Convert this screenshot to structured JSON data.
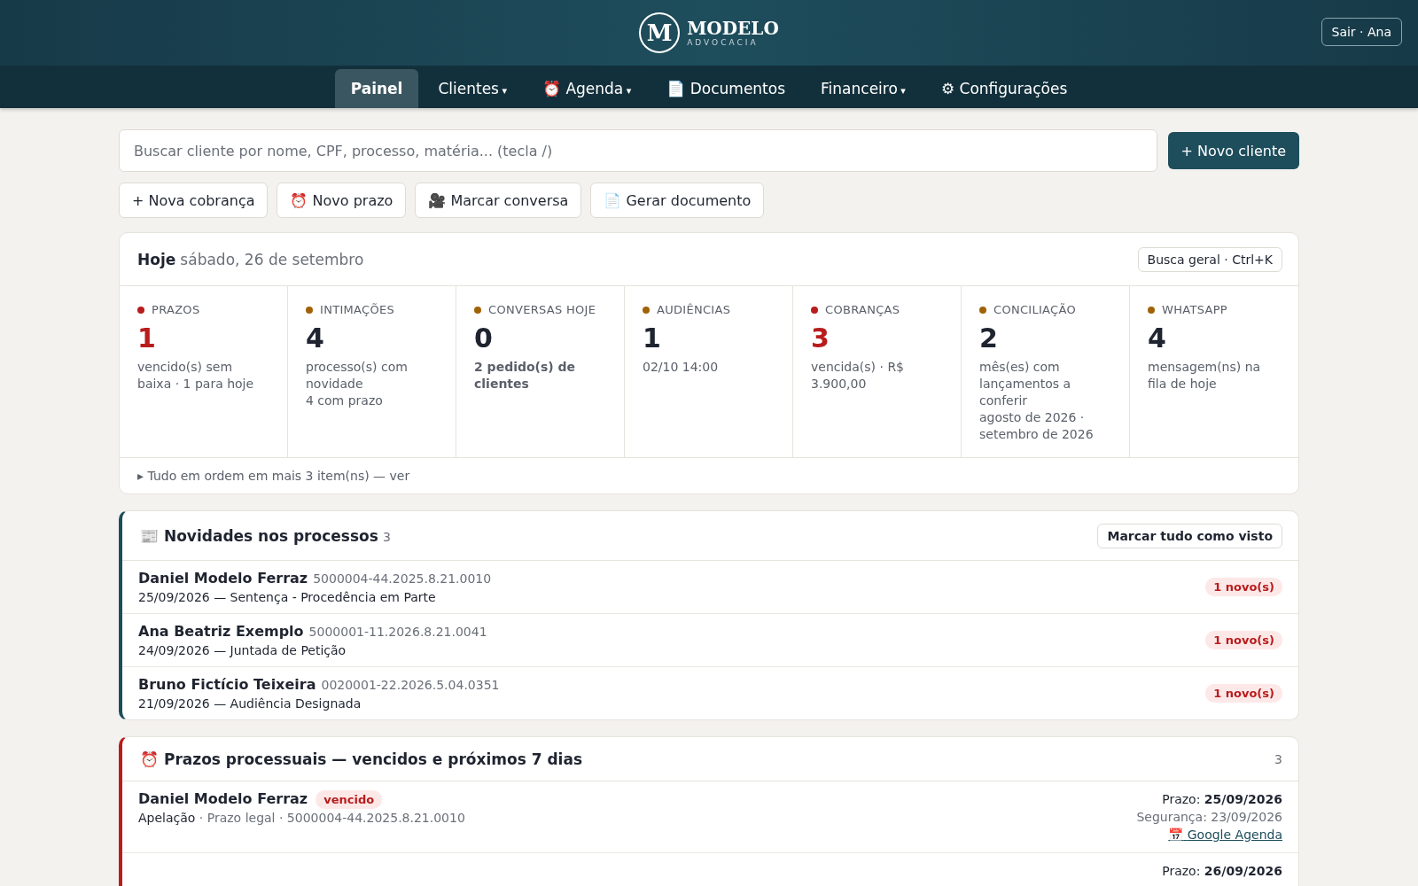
{
  "header": {
    "logo_letter": "M",
    "brand": "MODELO",
    "tagline": "ADVOCACIA",
    "logout": "Sair · Ana"
  },
  "nav": [
    {
      "label": "Painel",
      "selected": true
    },
    {
      "label": "Clientes",
      "caret": "▾",
      "selected": false
    },
    {
      "icon": "⏰",
      "label": "Agenda",
      "caret": "▾",
      "selected": false
    },
    {
      "icon": "📄",
      "label": "Documentos",
      "selected": false
    },
    {
      "label": "Financeiro",
      "caret": "▾",
      "selected": false
    },
    {
      "icon": "⚙",
      "label": "Configurações",
      "selected": false
    }
  ],
  "search": {
    "placeholder": "Buscar cliente por nome, CPF, processo, matéria... (tecla /)"
  },
  "new_client": "+ Novo cliente",
  "quick_actions": [
    {
      "icon": "+",
      "label": "Nova cobrança"
    },
    {
      "icon": "⏰",
      "label": "Novo prazo"
    },
    {
      "icon": "🎥",
      "label": "Marcar conversa"
    },
    {
      "icon": "📄",
      "label": "Gerar documento"
    }
  ],
  "today": {
    "title": "Hoje",
    "date": "sábado, 26 de setembro",
    "search_button": "Busca geral · Ctrl+K",
    "metrics": [
      {
        "label": "PRAZOS",
        "color": "#b91c1c",
        "value": "1",
        "alert": true,
        "lines": [
          {
            "text": "vencido(s) sem baixa · 1 para hoje",
            "bold": false
          }
        ]
      },
      {
        "label": "INTIMAÇÕES",
        "color": "#a16207",
        "value": "4",
        "alert": false,
        "lines": [
          {
            "text": "processo(s) com novidade",
            "bold": false
          },
          {
            "text": "4 com prazo",
            "bold": false
          }
        ]
      },
      {
        "label": "CONVERSAS HOJE",
        "color": "#a16207",
        "value": "0",
        "alert": false,
        "lines": [
          {
            "text": "2 pedido(s) de clientes",
            "bold": true
          }
        ]
      },
      {
        "label": "AUDIÊNCIAS",
        "color": "#a16207",
        "value": "1",
        "alert": false,
        "lines": [
          {
            "text": "02/10 14:00",
            "bold": false
          }
        ]
      },
      {
        "label": "COBRANÇAS",
        "color": "#b91c1c",
        "value": "3",
        "alert": true,
        "lines": [
          {
            "text": "vencida(s) · R$ 3.900,00",
            "bold": false
          }
        ]
      },
      {
        "label": "CONCILIAÇÃO",
        "color": "#a16207",
        "value": "2",
        "alert": false,
        "lines": [
          {
            "text": "mês(es) com lançamentos a conferir",
            "bold": false
          },
          {
            "text": "agosto de 2026 · setembro de 2026",
            "bold": false
          }
        ]
      },
      {
        "label": "WHATSAPP",
        "color": "#a16207",
        "value": "4",
        "alert": false,
        "lines": [
          {
            "text": "mensagem(ns) na fila de hoje",
            "bold": false
          }
        ]
      }
    ],
    "footer": "▸ Tudo em ordem em mais 3 item(ns) — ver"
  },
  "news": {
    "icon": "📰",
    "title": "Novidades nos processos",
    "count": "3",
    "color": "#1e4d5c",
    "action": "Marcar tudo como visto",
    "items": [
      {
        "name": "Daniel Modelo Ferraz",
        "process": "5000004-44.2025.8.21.0010",
        "detail": "25/09/2026 — Sentença - Procedência em Parte",
        "badge": "1 novo(s)"
      },
      {
        "name": "Ana Beatriz Exemplo",
        "process": "5000001-11.2026.8.21.0041",
        "detail": "24/09/2026 — Juntada de Petição",
        "badge": "1 novo(s)"
      },
      {
        "name": "Bruno Fictício Teixeira",
        "process": "0020001-22.2026.5.04.0351",
        "detail": "21/09/2026 — Audiência Designada",
        "badge": "1 novo(s)"
      }
    ]
  },
  "deadlines": {
    "icon": "⏰",
    "title": "Prazos processuais — vencidos e próximos 7 dias",
    "count": "3",
    "color": "#b91c1c",
    "items": [
      {
        "name": "Daniel Modelo Ferraz",
        "status": "vencido",
        "kind_label": "Apelação",
        "meta": "· Prazo legal · 5000004-44.2025.8.21.0010",
        "due_label": "Prazo:",
        "due": "25/09/2026",
        "safety": "Segurança: 23/09/2026",
        "calendar_icon": "📅",
        "calendar_link": "Google Agenda"
      },
      {
        "due_label": "Prazo:",
        "due": "26/09/2026"
      }
    ]
  }
}
